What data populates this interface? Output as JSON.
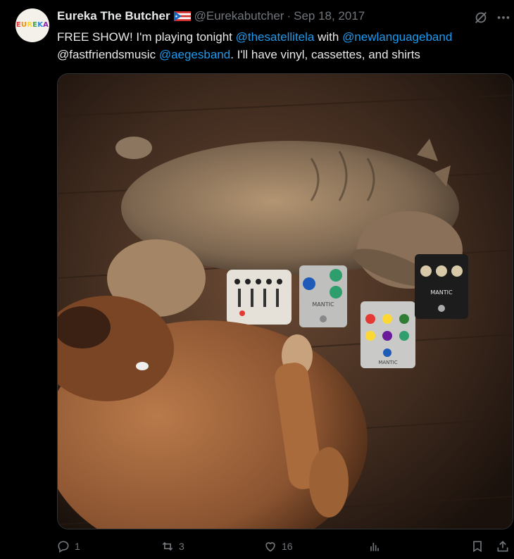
{
  "author": {
    "avatar_text": "EUREKA",
    "name": "Eureka The Butcher",
    "handle": "@Eurekabutcher",
    "separator": "·",
    "date": "Sep 18, 2017"
  },
  "tweet_text": {
    "part1": "FREE SHOW! I'm playing tonight ",
    "mention1": "@thesatellitela",
    "part2": " with ",
    "mention2": "@newlanguageband",
    "part3": " @fastfriendsmusic ",
    "mention3": "@aegesband",
    "part4": ". I'll have vinyl, cassettes, and shirts"
  },
  "media": {
    "pedal_labels": [
      "MANTIC",
      "MANTIC",
      "MANTIC"
    ]
  },
  "actions": {
    "replies": "1",
    "reposts": "3",
    "likes": "16"
  },
  "colors": {
    "accent": "#1d9bf0",
    "muted": "#71767b",
    "text": "#e7e9ea",
    "background": "#000000"
  },
  "icons": [
    "grok-icon",
    "more-icon",
    "reply-icon",
    "repost-icon",
    "like-icon",
    "views-icon",
    "bookmark-icon",
    "share-icon",
    "flag-icon"
  ]
}
